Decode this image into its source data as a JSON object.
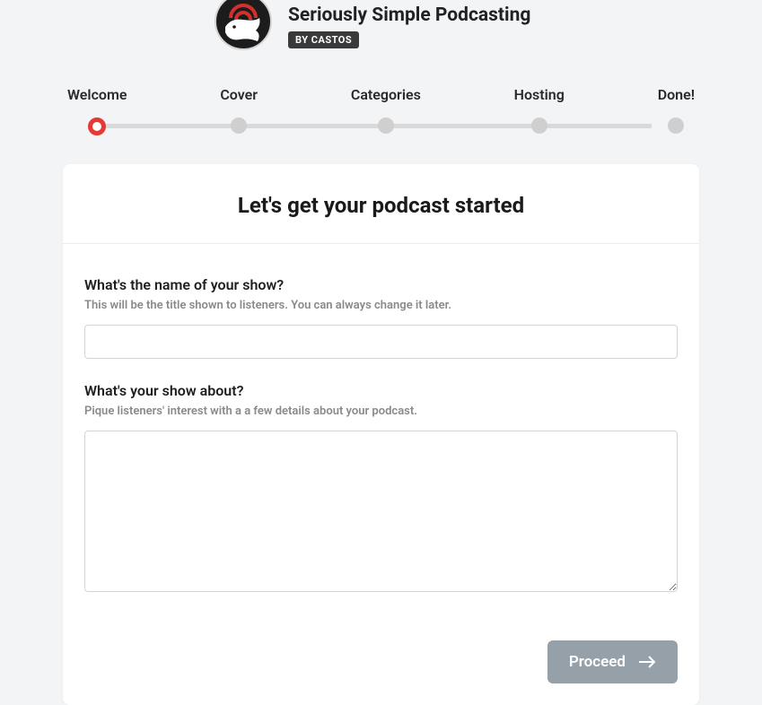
{
  "brand": {
    "title": "Seriously Simple Podcasting",
    "badge": "BY CASTOS"
  },
  "stepper": {
    "steps": [
      {
        "label": "Welcome",
        "active": true
      },
      {
        "label": "Cover",
        "active": false
      },
      {
        "label": "Categories",
        "active": false
      },
      {
        "label": "Hosting",
        "active": false
      },
      {
        "label": "Done!",
        "active": false
      }
    ]
  },
  "card": {
    "title": "Let's get your podcast started"
  },
  "form": {
    "name_label": "What's the name of your show?",
    "name_hint": "This will be the title shown to listeners. You can always change it later.",
    "name_value": "",
    "about_label": "What's your show about?",
    "about_hint": "Pique listeners' interest with a a few details about your podcast.",
    "about_value": ""
  },
  "actions": {
    "proceed_label": "Proceed"
  }
}
